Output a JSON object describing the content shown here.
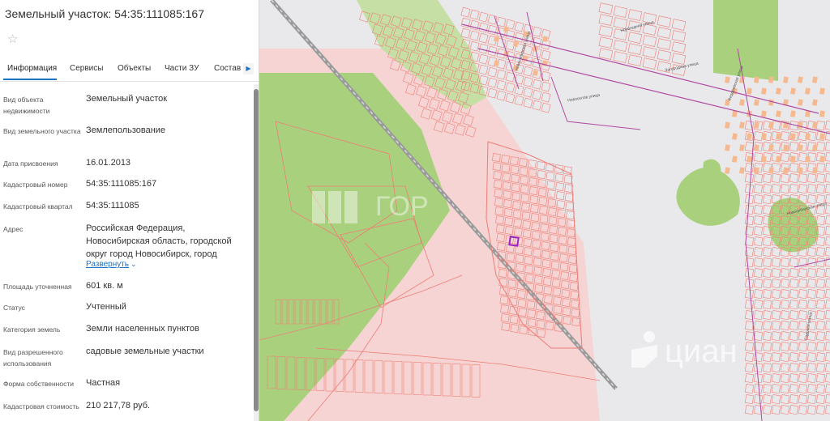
{
  "panel": {
    "title": "Земельный участок: 54:35:111085:167",
    "favorite_icon": "star-outline-icon",
    "tabs": [
      {
        "label": "Информация",
        "active": true
      },
      {
        "label": "Сервисы",
        "active": false
      },
      {
        "label": "Объекты",
        "active": false
      },
      {
        "label": "Части ЗУ",
        "active": false
      },
      {
        "label": "Состав",
        "active": false
      }
    ],
    "tabs_more_icon": "triangle-right-icon",
    "expand_label": "Развернуть",
    "expand_icon": "chevron-down-icon",
    "properties": [
      {
        "label": "Вид объекта недвижимости",
        "value": "Земельный участок"
      },
      {
        "label": "Вид земельного участка",
        "value": "Землепользование"
      },
      {
        "label": "Дата присвоения",
        "value": "16.01.2013"
      },
      {
        "label": "Кадастровый номер",
        "value": "54:35:111085:167"
      },
      {
        "label": "Кадастровый квартал",
        "value": "54:35:111085"
      },
      {
        "label": "Адрес",
        "value": "Российская Федерация, Новосибирская область, городской округ город Новосибирск, город"
      },
      {
        "label": "Площадь уточненная",
        "value": "601 кв. м"
      },
      {
        "label": "Статус",
        "value": "Учтенный"
      },
      {
        "label": "Категория земель",
        "value": "Земли населенных пунктов"
      },
      {
        "label": "Вид разрешенного использования",
        "value": "садовые земельные участки"
      },
      {
        "label": "Форма собственности",
        "value": "Частная"
      },
      {
        "label": "Кадастровая стоимость",
        "value": "210 217,78 руб."
      }
    ]
  },
  "map": {
    "colors": {
      "background": "#e9e9ec",
      "forest": "#a9d17d",
      "zone_pink": "#f5d4d3",
      "parcel_outline": "#ee7d75",
      "quarter_outline": "#b04aa0",
      "selected_parcel": "#9b23c6",
      "building": "#f6b98f",
      "railway": "#9a9a9a"
    },
    "street_labels": [
      "Новосибирская улица",
      "Новогодняя улица",
      "Новоселов улица",
      "Загородная улица",
      "Федоровская улица",
      "Новосибирская улица",
      "Садовая улица"
    ],
    "watermarks": {
      "gor_text": "ГОР",
      "cian_text": "циан",
      "gor_icon": "gor-logo-icon",
      "cian_icon": "cian-logo-icon"
    }
  }
}
